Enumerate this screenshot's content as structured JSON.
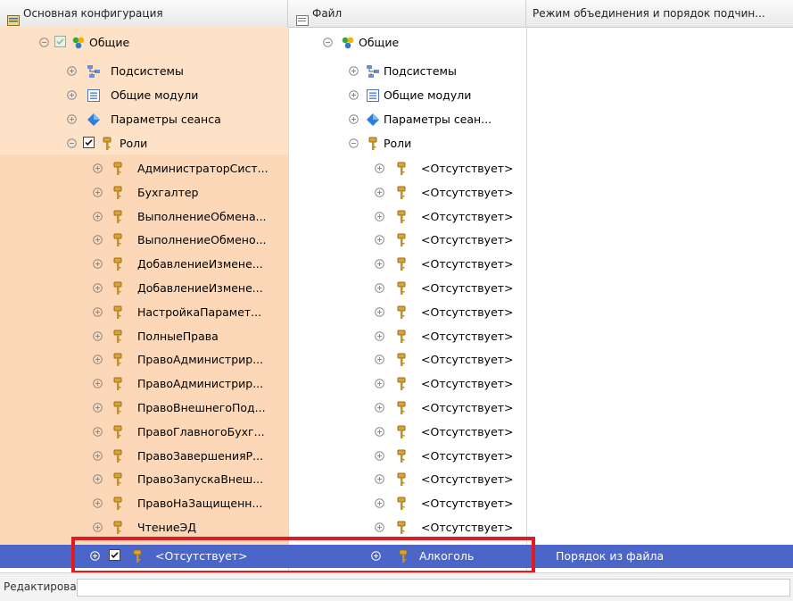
{
  "header": {
    "col1": "Основная конфигурация",
    "col2": "Файл",
    "col3": "Режим объединения и порядок подчин..."
  },
  "tree": {
    "obshie_left": "Общие",
    "obshie_right": "Общие",
    "podsistemy": "Подсистемы",
    "moduli": "Общие модули",
    "params_left": "Параметры сеанса",
    "params_right": "Параметры сеан...",
    "roli": "Роли"
  },
  "roles_left": [
    "АдминистраторСист...",
    "Бухгалтер",
    "ВыполнениеОбмена...",
    "ВыполнениеОбмено...",
    "ДобавлениеИзмене...",
    "ДобавлениеИзмене...",
    "НастройкаПарамет...",
    "ПолныеПрава",
    "ПравоАдминистрир...",
    "ПравоАдминистрир...",
    "ПравоВнешнегоПод...",
    "ПравоГлавногоБухг...",
    "ПравоЗавершенияР...",
    "ПравоЗапускаВнеш...",
    "ПравоНаЗащищенн...",
    "ЧтениеЭД"
  ],
  "missing_label": "<Отсутствует>",
  "selected": {
    "left": "<Отсутствует>",
    "right": "Алкоголь",
    "mode": "Порядок из файла"
  },
  "status": {
    "label": "Редактирование:",
    "value": ""
  }
}
